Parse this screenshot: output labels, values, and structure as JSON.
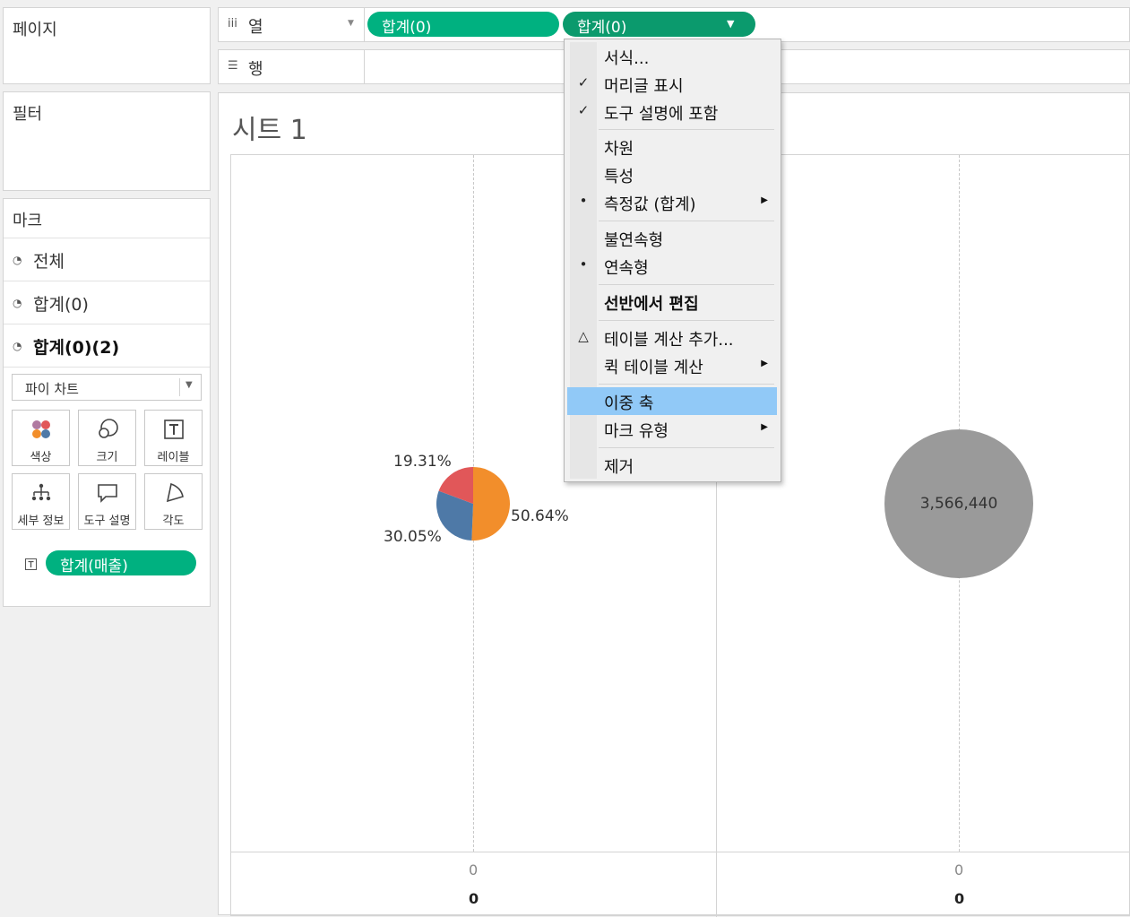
{
  "panels": {
    "pages": "페이지",
    "filters": "필터",
    "marks": "마크"
  },
  "marks": {
    "rows": [
      {
        "label": "전체"
      },
      {
        "label": "합계(0)"
      },
      {
        "label": "합계(0)(2)"
      }
    ],
    "mark_type": "파이 차트",
    "cards": {
      "color": "색상",
      "size": "크기",
      "label": "레이블",
      "detail": "세부 정보",
      "tooltip": "도구 설명",
      "angle": "각도"
    },
    "field_pill": "합계(매출)"
  },
  "shelves": {
    "columns_label": "열",
    "rows_label": "행",
    "pill1": "합계(0)",
    "pill2": "합계(0)"
  },
  "sheet": {
    "title": "시트 1"
  },
  "chart_data": {
    "type": "pie",
    "title": "",
    "left_pie": {
      "slices": [
        {
          "label": "50.64%",
          "value": 50.64,
          "color": "#f28e2b"
        },
        {
          "label": "30.05%",
          "value": 30.05,
          "color": "#4e79a7"
        },
        {
          "label": "19.31%",
          "value": 19.31,
          "color": "#e15759"
        }
      ]
    },
    "right_pie": {
      "slices": [
        {
          "label": "3,566,440",
          "value": 3566440,
          "color": "#9a9a9a"
        }
      ]
    },
    "x_ticks": [
      "0",
      "0"
    ],
    "x_headers": [
      "0",
      "0"
    ]
  },
  "menu": {
    "items": [
      {
        "label": "서식...",
        "mark": ""
      },
      {
        "label": "머리글 표시",
        "mark": "✓"
      },
      {
        "label": "도구 설명에 포함",
        "mark": "✓"
      },
      {
        "label": "차원",
        "mark": ""
      },
      {
        "label": "특성",
        "mark": ""
      },
      {
        "label": "측정값 (합계)",
        "mark": "•",
        "submenu": "▶"
      },
      {
        "label": "불연속형",
        "mark": ""
      },
      {
        "label": "연속형",
        "mark": "•"
      },
      {
        "label": "선반에서 편집",
        "mark": ""
      },
      {
        "label": "테이블 계산 추가...",
        "mark": "△"
      },
      {
        "label": "퀵 테이블 계산",
        "mark": "",
        "submenu": "▶"
      },
      {
        "label": "이중 축",
        "mark": ""
      },
      {
        "label": "마크 유형",
        "mark": "",
        "submenu": "▶"
      },
      {
        "label": "제거",
        "mark": ""
      }
    ]
  },
  "colors": {
    "pill_green": "#00b180",
    "pill_green_dark": "#0b9a6d",
    "menu_highlight": "#91c9f7"
  }
}
